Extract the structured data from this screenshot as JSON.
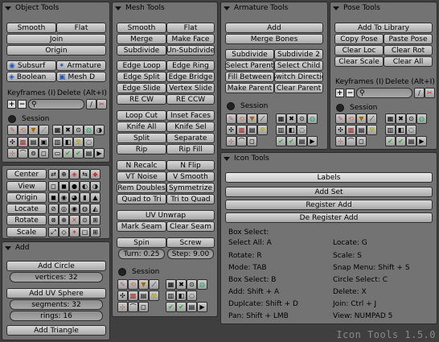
{
  "object_tools": {
    "title": "Object Tools",
    "smooth": "Smooth",
    "flat": "Flat",
    "join": "Join",
    "origin": "Origin",
    "subsurf": "Subsurf",
    "armature": "Armature",
    "boolean": "Boolean",
    "meshd": "Mesh D",
    "keyframes": "Keyframes (I)",
    "delete": "Delete (Alt+I)",
    "session": "Session"
  },
  "transform": {
    "center": "Center",
    "view": "View",
    "origin": "Origin",
    "locate": "Locate",
    "rotate": "Rotate",
    "scale": "Scale"
  },
  "add": {
    "title": "Add",
    "add_circle": "Add Circle",
    "vertices": "vertices: 32",
    "add_uv_sphere": "Add UV Sphere",
    "segments": "segments: 32",
    "rings": "rings: 16",
    "add_triangle": "Add Triangle"
  },
  "mesh_tools": {
    "title": "Mesh Tools",
    "smooth": "Smooth",
    "flat": "Flat",
    "merge": "Merge",
    "make_face": "Make Face",
    "subdivide": "Subdivide",
    "un_subdivide": "Un-Subdivide",
    "edge_loop": "Edge Loop",
    "edge_ring": "Edge Ring",
    "edge_split": "Edge Split",
    "edge_bridge": "Edge Bridge",
    "edge_slide": "Edge Slide",
    "vertex_slide": "Vertex Slide",
    "re_cw": "RE CW",
    "re_ccw": "RE CCW",
    "loop_cut": "Loop Cut",
    "inset_faces": "Inset Faces",
    "knife_all": "Knife All",
    "knife_sel": "Knife Sel",
    "split": "Split",
    "separate": "Separate",
    "rip": "Rip",
    "rip_fill": "Rip Fill",
    "n_recalc": "N Recalc",
    "n_flip": "N Flip",
    "vt_noise": "VT Noise",
    "v_smooth": "V Smooth",
    "rem_doubles": "Rem Doubles",
    "symmetrize": "Symmetrize",
    "quad_to_tri": "Quad to Tri",
    "tri_to_quad": "Tri to Quad",
    "uv_unwrap": "UV Unwrap",
    "mark_seam": "Mark Seam",
    "clear_seam": "Clear Seam",
    "spin": "Spin",
    "screw": "Screw",
    "turn": "Turn: 0.25",
    "step": "Step: 9.00",
    "session": "Session"
  },
  "armature_tools": {
    "title": "Armature Tools",
    "add": "Add",
    "merge_bones": "Merge Bones",
    "subdivide": "Subdivide",
    "subdivide2": "Subdivide 2",
    "select_parent": "Select Parent",
    "select_child": "Select Child",
    "fill_between": "Fill Between",
    "switch_direction": "Switch Directio",
    "make_parent": "Make Parent",
    "clear_parent": "Clear Parent",
    "session": "Session"
  },
  "pose_tools": {
    "title": "Pose Tools",
    "add_to_library": "Add To Library",
    "copy_pose": "Copy Pose",
    "paste_pose": "Paste Pose",
    "clear_loc": "Clear Loc",
    "clear_rot": "Clear Rot",
    "clear_scale": "Clear Scale",
    "clear_all": "Clear All",
    "keyframes": "Keyframes (I)",
    "delete": "Delete (Alt+I)",
    "session": "Session"
  },
  "icon_tools": {
    "title": "Icon Tools",
    "labels": "Labels",
    "add_set": "Add Set",
    "register_add": "Register Add",
    "de_register_add": "De Register Add",
    "shortcuts_left": [
      "Box Select:",
      "Select All: A",
      "Rotate: R",
      "Mode: TAB",
      "Box Select: B",
      "Add: Shift + A",
      "Duplcate: Shift + D",
      "Pan: Shift + LMB"
    ],
    "shortcuts_right": [
      "Locate: G",
      "Scale: S",
      "Snap Menu: Shift + S",
      "Circle Select: C",
      "Delete: X",
      "Join: Ctrl + J",
      "View: NUMPAD 5"
    ]
  },
  "watermark": "Icon Tools 1.5.0",
  "colors": {
    "panel": "#737373",
    "background": "#3f3f3f",
    "button": "#c4c4c4"
  }
}
